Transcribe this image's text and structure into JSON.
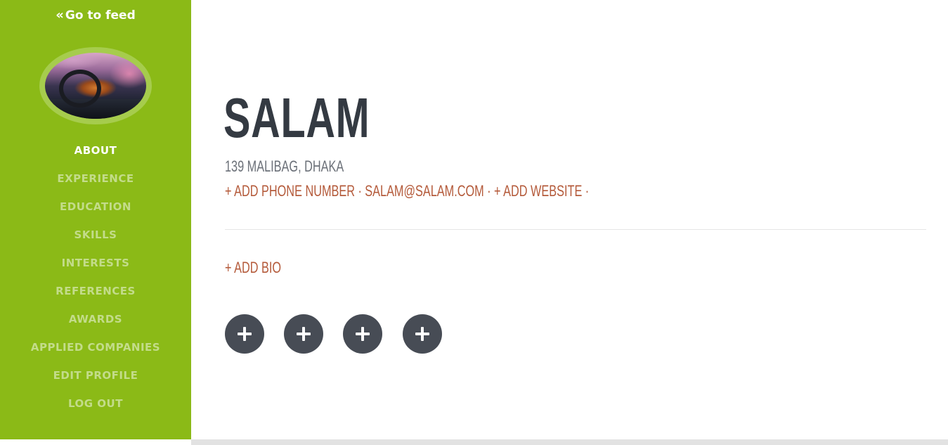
{
  "sidebar": {
    "go_to_feed": {
      "icon": "chevrons-left-icon",
      "glyph": "«",
      "label": "Go to feed"
    },
    "nav": [
      {
        "label": "ABOUT",
        "active": true
      },
      {
        "label": "EXPERIENCE",
        "active": false
      },
      {
        "label": "EDUCATION",
        "active": false
      },
      {
        "label": "SKILLS",
        "active": false
      },
      {
        "label": "INTERESTS",
        "active": false
      },
      {
        "label": "REFERENCES",
        "active": false
      },
      {
        "label": "AWARDS",
        "active": false
      },
      {
        "label": "APPLIED COMPANIES",
        "active": false
      },
      {
        "label": "EDIT PROFILE",
        "active": false
      },
      {
        "label": "LOG OUT",
        "active": false
      }
    ]
  },
  "profile": {
    "name": "SALAM",
    "address": "139 MALIBAG, DHAKA",
    "add_phone": "+ ADD PHONE NUMBER",
    "email": "SALAM@SALAM.COM",
    "add_website": "+ ADD WEBSITE",
    "separator": "·",
    "add_bio": "+ ADD BIO"
  },
  "social_buttons": [
    {
      "icon": "plus-icon"
    },
    {
      "icon": "plus-icon"
    },
    {
      "icon": "plus-icon"
    },
    {
      "icon": "plus-icon"
    }
  ],
  "colors": {
    "sidebar_bg": "#8bba17",
    "nav_active": "#ffffff",
    "nav_inactive": "#c3dc8a",
    "name_text": "#343a42",
    "link_accent": "#b45a3a",
    "social_button_bg": "#474c55"
  }
}
